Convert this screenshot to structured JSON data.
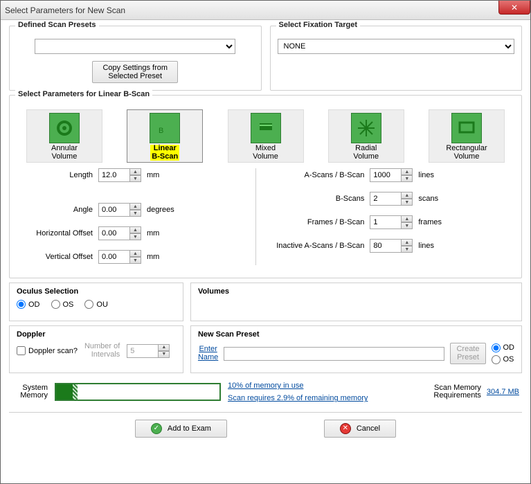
{
  "window": {
    "title": "Select Parameters for New Scan"
  },
  "presets": {
    "group_title": "Defined Scan Presets",
    "selected": "",
    "copy_btn": "Copy Settings from\nSelected Preset"
  },
  "fixation": {
    "group_title": "Select Fixation Target",
    "selected": "NONE"
  },
  "scantype": {
    "group_title": "Select Parameters for Linear B-Scan",
    "tiles": [
      {
        "label": "Annular\nVolume"
      },
      {
        "label": "Linear\nB-Scan",
        "selected": true
      },
      {
        "label": "Mixed\nVolume"
      },
      {
        "label": "Radial\nVolume"
      },
      {
        "label": "Rectangular\nVolume"
      }
    ]
  },
  "left": {
    "length": {
      "label": "Length",
      "value": "12.0",
      "unit": "mm"
    },
    "angle": {
      "label": "Angle",
      "value": "0.00",
      "unit": "degrees"
    },
    "hoff": {
      "label": "Horizontal Offset",
      "value": "0.00",
      "unit": "mm"
    },
    "voff": {
      "label": "Vertical Offset",
      "value": "0.00",
      "unit": "mm"
    }
  },
  "right": {
    "ascans": {
      "label": "A-Scans / B-Scan",
      "value": "1000",
      "unit": "lines"
    },
    "bscans": {
      "label": "B-Scans",
      "value": "2",
      "unit": "scans"
    },
    "frames": {
      "label": "Frames / B-Scan",
      "value": "1",
      "unit": "frames"
    },
    "inactive": {
      "label": "Inactive A-Scans / B-Scan",
      "value": "80",
      "unit": "lines"
    }
  },
  "oculus": {
    "title": "Oculus Selection",
    "od": "OD",
    "os": "OS",
    "ou": "OU",
    "selected": "OD"
  },
  "volumes": {
    "title": "Volumes"
  },
  "doppler": {
    "title": "Doppler",
    "check_label": "Doppler scan?",
    "intervals_label": "Number of\nIntervals",
    "intervals_value": "5"
  },
  "newpreset": {
    "title": "New Scan Preset",
    "enter_name": "Enter\nName",
    "value": "",
    "create_btn": "Create\nPreset",
    "od": "OD",
    "os": "OS"
  },
  "memory": {
    "label": "System\nMemory",
    "use_text": "10% of memory in use",
    "need_text": "Scan requires 2.9% of remaining memory",
    "req_label": "Scan Memory\nRequirements",
    "req_value": "304.7 MB"
  },
  "footer": {
    "add": "Add to Exam",
    "cancel": "Cancel"
  }
}
